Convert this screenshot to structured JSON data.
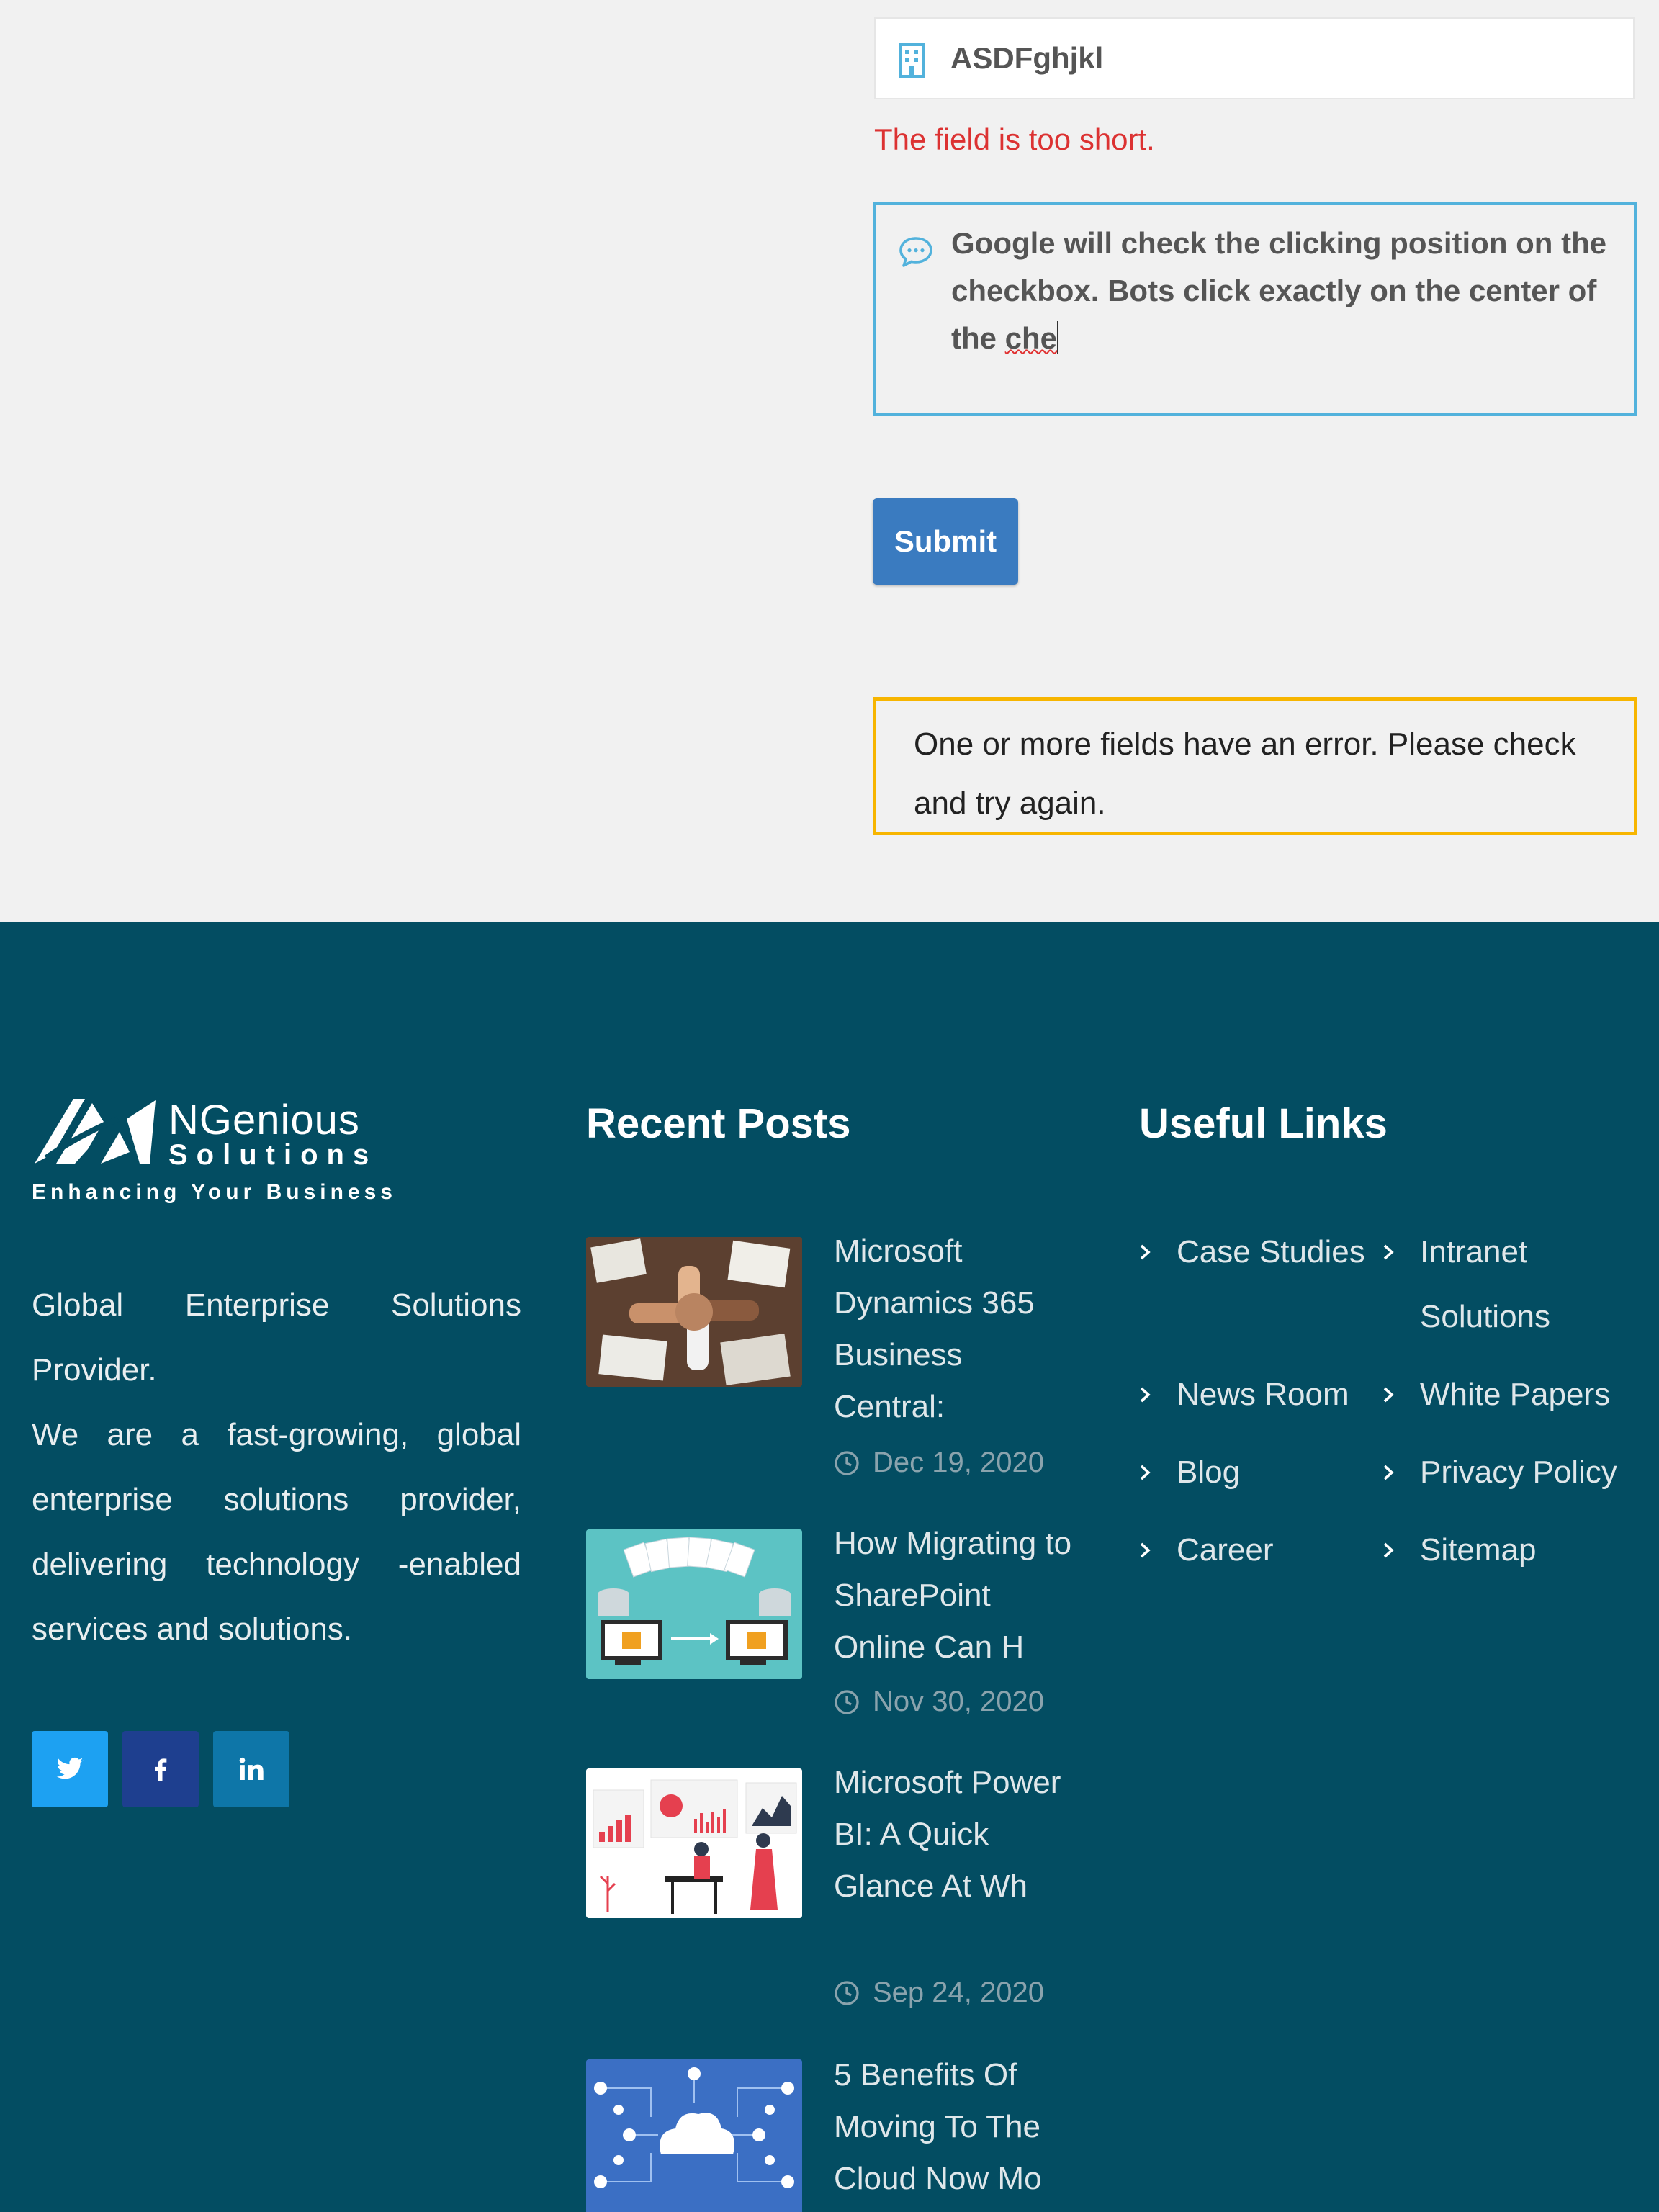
{
  "form": {
    "company_value": "ASDFghjkl",
    "company_icon": "building-icon",
    "error_tip": "The field is too short.",
    "message_before": "Google will check the clicking position on the checkbox. Bots click exactly on the center of the ",
    "message_typo": "che",
    "message_icon": "chat-bubble-icon",
    "submit_label": "Submit",
    "response_message": "One or more fields have an error. Please check and try again.",
    "colors": {
      "error": "#dc3232",
      "focus_border": "#52b2dc",
      "submit": "#3a7bc0",
      "warning_border": "#f7b500"
    }
  },
  "footer": {
    "background": "#034d62",
    "logo": {
      "name": "NGenious",
      "sub": "Solutions",
      "tagline": "Enhancing Your Business"
    },
    "about_line1": "Global Enterprise Solutions Provider.",
    "about_line2": "We are a fast-growing, global enterprise solutions provider, delivering technology -enabled services and solutions.",
    "social": [
      {
        "name": "twitter-icon",
        "color": "#1da1f2"
      },
      {
        "name": "facebook-icon",
        "color": "#1e3f8f"
      },
      {
        "name": "linkedin-icon",
        "color": "#0e76a8"
      }
    ],
    "recent_posts_title": "Recent Posts",
    "posts": [
      {
        "title": "Microsoft Dynamics 365 Business Central:",
        "date": "Dec 19, 2020"
      },
      {
        "title": "How Migrating to SharePoint Online Can H",
        "date": "Nov 30, 2020"
      },
      {
        "title": "Microsoft Power BI: A Quick Glance At Wh",
        "date": "Sep 24, 2020"
      },
      {
        "title": "5 Benefits Of Moving To The Cloud Now Mo",
        "date": ""
      }
    ],
    "useful_links_title": "Useful Links",
    "links": [
      {
        "label": "Case Studies"
      },
      {
        "label": "Intranet Solutions"
      },
      {
        "label": "News Room"
      },
      {
        "label": "White Papers"
      },
      {
        "label": "Blog"
      },
      {
        "label": "Privacy Policy"
      },
      {
        "label": "Career"
      },
      {
        "label": "Sitemap"
      }
    ]
  }
}
